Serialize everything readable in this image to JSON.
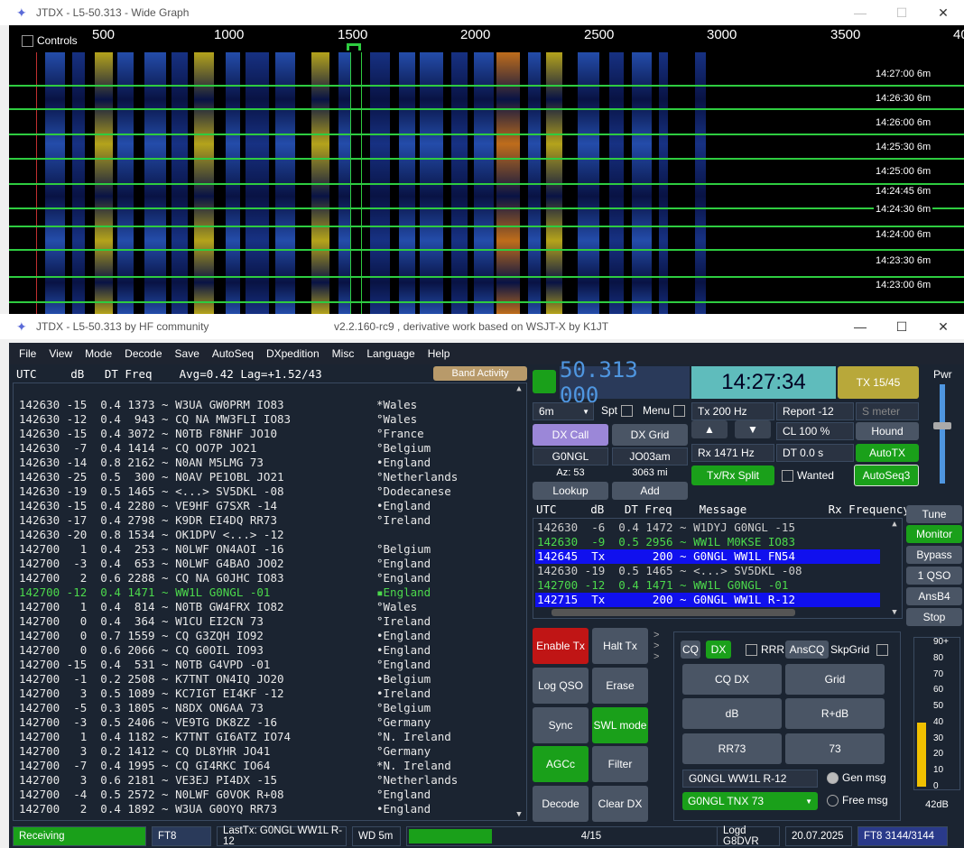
{
  "wide_graph": {
    "title": "JTDX - L5-50.313 - Wide Graph",
    "controls_label": "Controls",
    "freq_ticks": [
      "500",
      "1000",
      "1500",
      "2000",
      "2500",
      "3000",
      "3500",
      "40"
    ],
    "times": [
      "14:27:00  6m",
      "14:26:30  6m",
      "14:26:00  6m",
      "14:25:30  6m",
      "14:25:00  6m",
      "14:24:45  6m",
      "14:24:30  6m",
      "14:24:00  6m",
      "14:23:30  6m",
      "14:23:00  6m"
    ]
  },
  "main_window": {
    "title": "JTDX - L5-50.313   by HF community",
    "subtitle": "v2.2.160-rc9 , derivative work based on WSJT-X by K1JT"
  },
  "menu": [
    "File",
    "View",
    "Mode",
    "Decode",
    "Save",
    "AutoSeq",
    "DXpedition",
    "Misc",
    "Language",
    "Help"
  ],
  "decode_header": "UTC     dB   DT Freq    Avg=0.42 Lag=+1.52/43",
  "band_activity_label": "Band Activity",
  "decodes": [
    {
      "text": "142630 -15  0.4 1373 ~ W3UA GW0PRM IO83",
      "country": "*Wales",
      "hl": false
    },
    {
      "text": "142630 -12  0.4  943 ~ CQ NA MW3FLI IO83",
      "country": "°Wales",
      "hl": false
    },
    {
      "text": "142630 -15  0.4 3072 ~ N0TB F8NHF JO10",
      "country": "°France",
      "hl": false
    },
    {
      "text": "142630  -7  0.4 1414 ~ CQ OO7P JO21",
      "country": "°Belgium",
      "hl": false
    },
    {
      "text": "142630 -14  0.8 2162 ~ N0AN M5LMG 73",
      "country": "•England",
      "hl": false
    },
    {
      "text": "142630 -25  0.5  300 ~ N0AV PE1OBL JO21",
      "country": "°Netherlands",
      "hl": false
    },
    {
      "text": "142630 -19  0.5 1465 ~ <...> SV5DKL -08",
      "country": "°Dodecanese",
      "hl": false
    },
    {
      "text": "142630 -15  0.4 2280 ~ VE9HF G7SXR -14",
      "country": "•England",
      "hl": false
    },
    {
      "text": "142630 -17  0.4 2798 ~ K9DR EI4DQ RR73",
      "country": "°Ireland",
      "hl": false
    },
    {
      "text": "142630 -20  0.8 1534 ~ OK1DPV <...> -12",
      "country": "",
      "hl": false
    },
    {
      "text": "142700   1  0.4  253 ~ N0LWF ON4AOI -16",
      "country": "°Belgium",
      "hl": false
    },
    {
      "text": "142700  -3  0.4  653 ~ N0LWF G4BAO JO02",
      "country": "°England",
      "hl": false
    },
    {
      "text": "142700   2  0.6 2288 ~ CQ NA G0JHC IO83",
      "country": "°England",
      "hl": false
    },
    {
      "text": "142700 -12  0.4 1471 ~ WW1L G0NGL -01",
      "country": "▪England",
      "hl": true
    },
    {
      "text": "142700   1  0.4  814 ~ N0TB GW4FRX IO82",
      "country": "°Wales",
      "hl": false
    },
    {
      "text": "142700   0  0.4  364 ~ W1CU EI2CN 73",
      "country": "°Ireland",
      "hl": false
    },
    {
      "text": "142700   0  0.7 1559 ~ CQ G3ZQH IO92",
      "country": "•England",
      "hl": false
    },
    {
      "text": "142700   0  0.6 2066 ~ CQ G0OIL IO93",
      "country": "•England",
      "hl": false
    },
    {
      "text": "142700 -15  0.4  531 ~ N0TB G4VPD -01",
      "country": "°England",
      "hl": false
    },
    {
      "text": "142700  -1  0.2 2508 ~ K7TNT ON4IQ JO20",
      "country": "•Belgium",
      "hl": false
    },
    {
      "text": "142700   3  0.5 1089 ~ KC7IGT EI4KF -12",
      "country": "•Ireland",
      "hl": false
    },
    {
      "text": "142700  -5  0.3 1805 ~ N8DX ON6AA 73",
      "country": "°Belgium",
      "hl": false
    },
    {
      "text": "142700  -3  0.5 2406 ~ VE9TG DK8ZZ -16",
      "country": "°Germany",
      "hl": false
    },
    {
      "text": "142700   1  0.4 1182 ~ K7TNT GI6ATZ IO74",
      "country": "°N. Ireland",
      "hl": false
    },
    {
      "text": "142700   3  0.2 1412 ~ CQ DL8YHR JO41",
      "country": "°Germany",
      "hl": false
    },
    {
      "text": "142700  -7  0.4 1995 ~ CQ GI4RKC IO64",
      "country": "*N. Ireland",
      "hl": false
    },
    {
      "text": "142700   3  0.6 2181 ~ VE3EJ PI4DX -15",
      "country": "°Netherlands",
      "hl": false
    },
    {
      "text": "142700  -4  0.5 2572 ~ N0LWF G0VOK R+08",
      "country": "°England",
      "hl": false
    },
    {
      "text": "142700   2  0.4 1892 ~ W3UA G0OYQ RR73",
      "country": "•England",
      "hl": false
    }
  ],
  "radio": {
    "frequency": "50.313 000",
    "time": "14:27:34",
    "tx_slot": "TX 15/45",
    "pwr_label": "Pwr",
    "band": "6m",
    "spt": "Spt",
    "menu": "Menu",
    "tx_hz": "Tx  200  Hz",
    "report": "Report -12",
    "s_meter": "S meter",
    "cl": "CL  100 %",
    "hound": "Hound",
    "rx_hz": "Rx  1471  Hz",
    "dt": "DT 0.0 s",
    "autotx": "AutoTX",
    "txrx_split": "Tx/Rx Split",
    "wanted": "Wanted",
    "autoseq": "AutoSeq3",
    "dx_call_label": "DX Call",
    "dx_grid_label": "DX Grid",
    "dx_call": "G0NGL",
    "dx_grid": "JO03am",
    "az": "Az: 53",
    "dist": "3063 mi",
    "lookup": "Lookup",
    "add": "Add"
  },
  "rx_header": "UTC     dB   DT Freq    Message            Rx Frequency",
  "rx_rows": [
    {
      "text": "142630  -6  0.4 1472 ~ W1DYJ G0NGL -15",
      "kind": "normal"
    },
    {
      "text": "142630  -9  0.5 2956 ~ WW1L M0KSE IO83",
      "kind": "green"
    },
    {
      "text": "142645  Tx       200 ~ G0NGL WW1L FN54",
      "kind": "tx"
    },
    {
      "text": "142630 -19  0.5 1465 ~ <...> SV5DKL -08",
      "kind": "normal"
    },
    {
      "text": "142700 -12  0.4 1471 ~ WW1L G0NGL -01",
      "kind": "green"
    },
    {
      "text": "142715  Tx       200 ~ G0NGL WW1L R-12",
      "kind": "tx"
    }
  ],
  "right_buttons": [
    "Tune",
    "Monitor",
    "Bypass",
    "1 QSO",
    "AnsB4",
    "Stop"
  ],
  "ctrl_buttons": {
    "enable_tx": "Enable Tx",
    "halt_tx": "Halt Tx",
    "log_qso": "Log QSO",
    "erase": "Erase",
    "sync": "Sync",
    "swl_mode": "SWL mode",
    "agcc": "AGCc",
    "filter": "Filter",
    "decode": "Decode",
    "clear_dx": "Clear DX"
  },
  "tx_panel": {
    "cq": "CQ",
    "dx": "DX",
    "rrr": "RRR",
    "anscq": "AnsCQ",
    "skpgrid": "SkpGrid",
    "cq_dx": "CQ DX",
    "grid": "Grid",
    "db": "dB",
    "r_db": "R+dB",
    "rr73": "RR73",
    "s73": "73",
    "msg_field": "G0NGL WW1L R-12",
    "gen_msg": "Gen msg",
    "free_msg_value": "G0NGL TNX 73",
    "free_msg": "Free msg"
  },
  "meter": {
    "scale": [
      "90+",
      "80",
      "70",
      "60",
      "50",
      "40",
      "30",
      "20",
      "10",
      "0"
    ],
    "level_db": 40,
    "reading": "42dB"
  },
  "status_bar": {
    "state": "Receiving",
    "mode": "FT8",
    "last_tx": "LastTx: G0NGL WW1L R-12",
    "wd": "WD 5m",
    "progress": "4/15",
    "progress_fraction": 0.27,
    "logged": "Logd G8DVR",
    "date": "20.07.2025",
    "mode_count": "FT8  3144/3144"
  }
}
